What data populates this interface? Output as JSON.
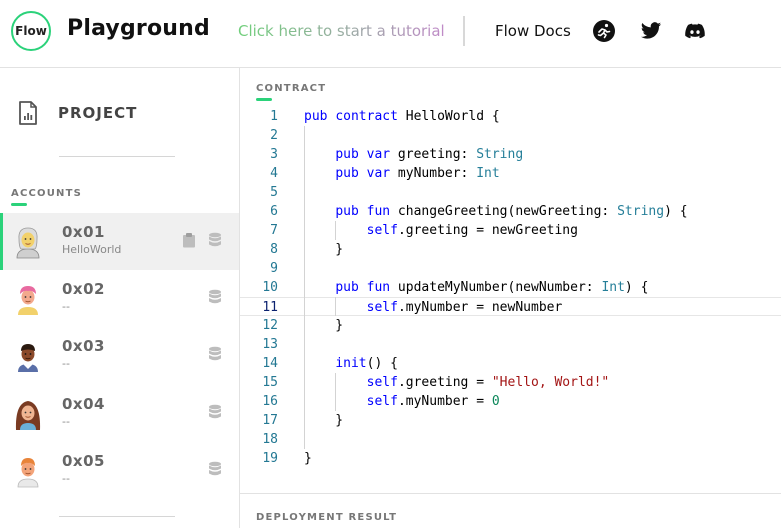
{
  "header": {
    "logo_text": "Flow",
    "title": "Playground",
    "tutorial_link": "Click here to start a tutorial",
    "docs_link": "Flow Docs",
    "icons": [
      "flow-runner-icon",
      "twitter-icon",
      "discord-icon"
    ]
  },
  "sidebar": {
    "project_label": "PROJECT",
    "accounts_heading": "ACCOUNTS",
    "accounts": [
      {
        "address": "0x01",
        "contract": "HelloWorld",
        "active": true
      },
      {
        "address": "0x02",
        "contract": "--",
        "active": false
      },
      {
        "address": "0x03",
        "contract": "--",
        "active": false
      },
      {
        "address": "0x04",
        "contract": "--",
        "active": false
      },
      {
        "address": "0x05",
        "contract": "--",
        "active": false
      }
    ]
  },
  "editor": {
    "heading": "CONTRACT",
    "active_line": 11,
    "lines": [
      "pub contract HelloWorld {",
      "",
      "    pub var greeting: String",
      "    pub var myNumber: Int",
      "",
      "    pub fun changeGreeting(newGreeting: String) {",
      "        self.greeting = newGreeting",
      "    }",
      "",
      "    pub fun updateMyNumber(newNumber: Int) {",
      "        self.myNumber = newNumber",
      "    }",
      "",
      "    init() {",
      "        self.greeting = \"Hello, World!\"",
      "        self.myNumber = 0",
      "    }",
      "",
      "}"
    ]
  },
  "deployment": {
    "heading": "DEPLOYMENT RESULT"
  },
  "colors": {
    "accent": "#2bd27a",
    "keyword": "#0000ff",
    "type": "#267f99",
    "string": "#a31515",
    "number": "#098658",
    "line_number": "#237893"
  }
}
